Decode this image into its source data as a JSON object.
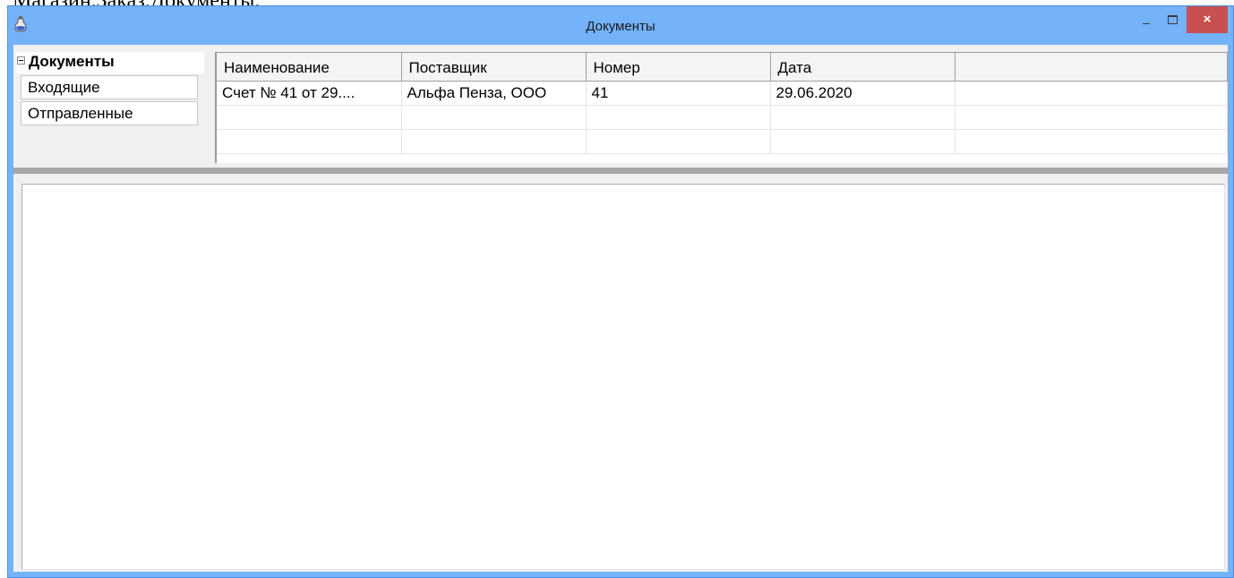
{
  "doc_text": "Магазин.Заказ.Документы.",
  "window": {
    "title": "Документы",
    "close_glyph": "×"
  },
  "tree": {
    "root_label": "Документы",
    "items": [
      "Входящие",
      "Отправленные"
    ]
  },
  "grid": {
    "columns": [
      "Наименование",
      "Поставщик",
      "Номер",
      "Дата",
      ""
    ],
    "rows": [
      [
        "Счет № 41 от 29....",
        "Альфа Пенза, ООО",
        "41",
        "29.06.2020",
        ""
      ],
      [
        "",
        "",
        "",
        "",
        ""
      ],
      [
        "",
        "",
        "",
        "",
        ""
      ]
    ]
  },
  "colors": {
    "titlebar": "#74b2fa",
    "close_button": "#c75050",
    "client_background": "#f0f0f0"
  },
  "icons": [
    "app-icon",
    "minimize-icon",
    "maximize-icon",
    "close-icon",
    "tree-collapse-icon"
  ]
}
